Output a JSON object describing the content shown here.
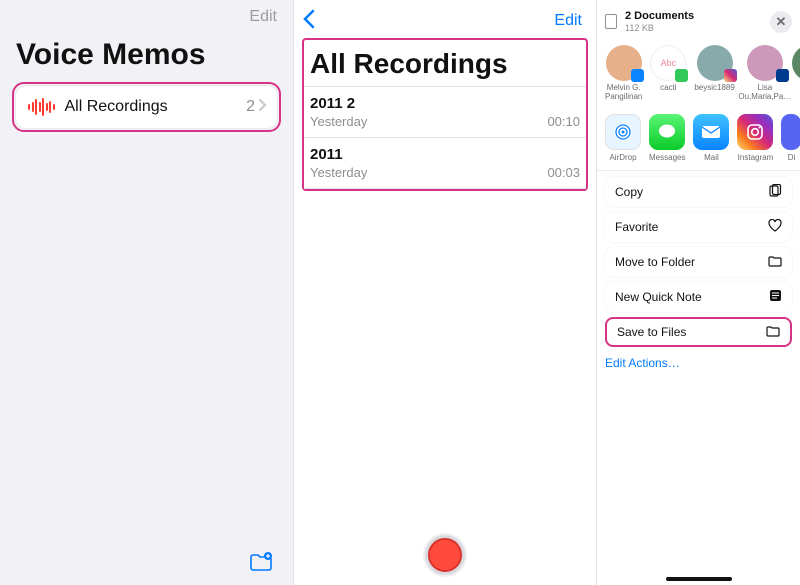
{
  "panel1": {
    "edit_label": "Edit",
    "title": "Voice Memos",
    "row": {
      "label": "All Recordings",
      "count": "2"
    }
  },
  "panel2": {
    "edit_label": "Edit",
    "title": "All Recordings",
    "recordings": [
      {
        "name": "2011 2",
        "sub": "Yesterday",
        "dur": "00:10"
      },
      {
        "name": "2011",
        "sub": "Yesterday",
        "dur": "00:03"
      }
    ]
  },
  "panel3": {
    "header": {
      "title": "2 Documents",
      "subtitle": "112 KB"
    },
    "contacts": [
      {
        "name": "Melvin G. Pangilinan",
        "badge": "blue"
      },
      {
        "name": "cacti",
        "badge": "green"
      },
      {
        "name": "beysic1889",
        "badge": "ig"
      },
      {
        "name": "Lisa Ou,Maria,Pa…",
        "badge": "navy"
      },
      {
        "name": "",
        "badge": ""
      }
    ],
    "apps": [
      {
        "name": "AirDrop"
      },
      {
        "name": "Messages"
      },
      {
        "name": "Mail"
      },
      {
        "name": "Instagram"
      },
      {
        "name": "Di"
      }
    ],
    "actions": {
      "copy": "Copy",
      "favorite": "Favorite",
      "move": "Move to Folder",
      "note": "New Quick Note",
      "save": "Save to Files"
    },
    "edit_actions": "Edit Actions…"
  }
}
